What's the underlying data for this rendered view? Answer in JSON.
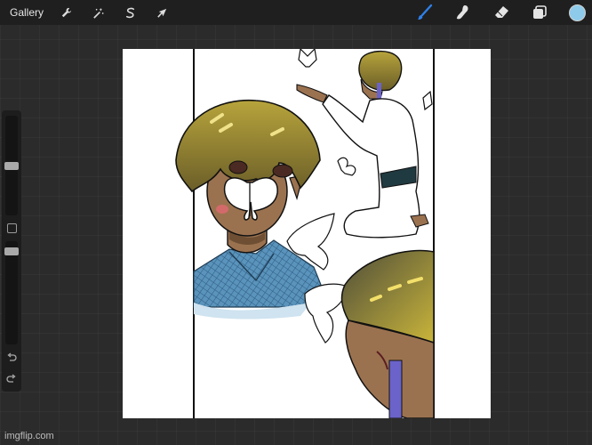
{
  "toolbar": {
    "gallery_label": "Gallery",
    "left_tools": [
      {
        "name": "actions",
        "icon": "wrench-icon"
      },
      {
        "name": "adjustments",
        "icon": "magic-wand-icon"
      },
      {
        "name": "selection",
        "icon": "selection-s-icon"
      },
      {
        "name": "transform",
        "icon": "arrow-cursor-icon"
      }
    ],
    "right_tools": [
      {
        "name": "brush",
        "icon": "brush-icon",
        "active": true
      },
      {
        "name": "smudge",
        "icon": "smudge-finger-icon"
      },
      {
        "name": "eraser",
        "icon": "eraser-icon"
      },
      {
        "name": "layers",
        "icon": "layers-icon"
      }
    ],
    "current_color": "#8ecbea",
    "active_tool_color": "#2f7fe8"
  },
  "sidebar": {
    "brush_size_level": 0.5,
    "opacity_level": 0.93,
    "undo_icon": "undo-icon",
    "redo_icon": "redo-icon"
  },
  "artwork": {
    "description_colors": {
      "hair": "#a19032",
      "skin": "#9b7250",
      "kimono": "#4f87ad",
      "sash": "#1f3a40",
      "headband": "#6b63c9"
    }
  },
  "watermark": "imgflip.com"
}
